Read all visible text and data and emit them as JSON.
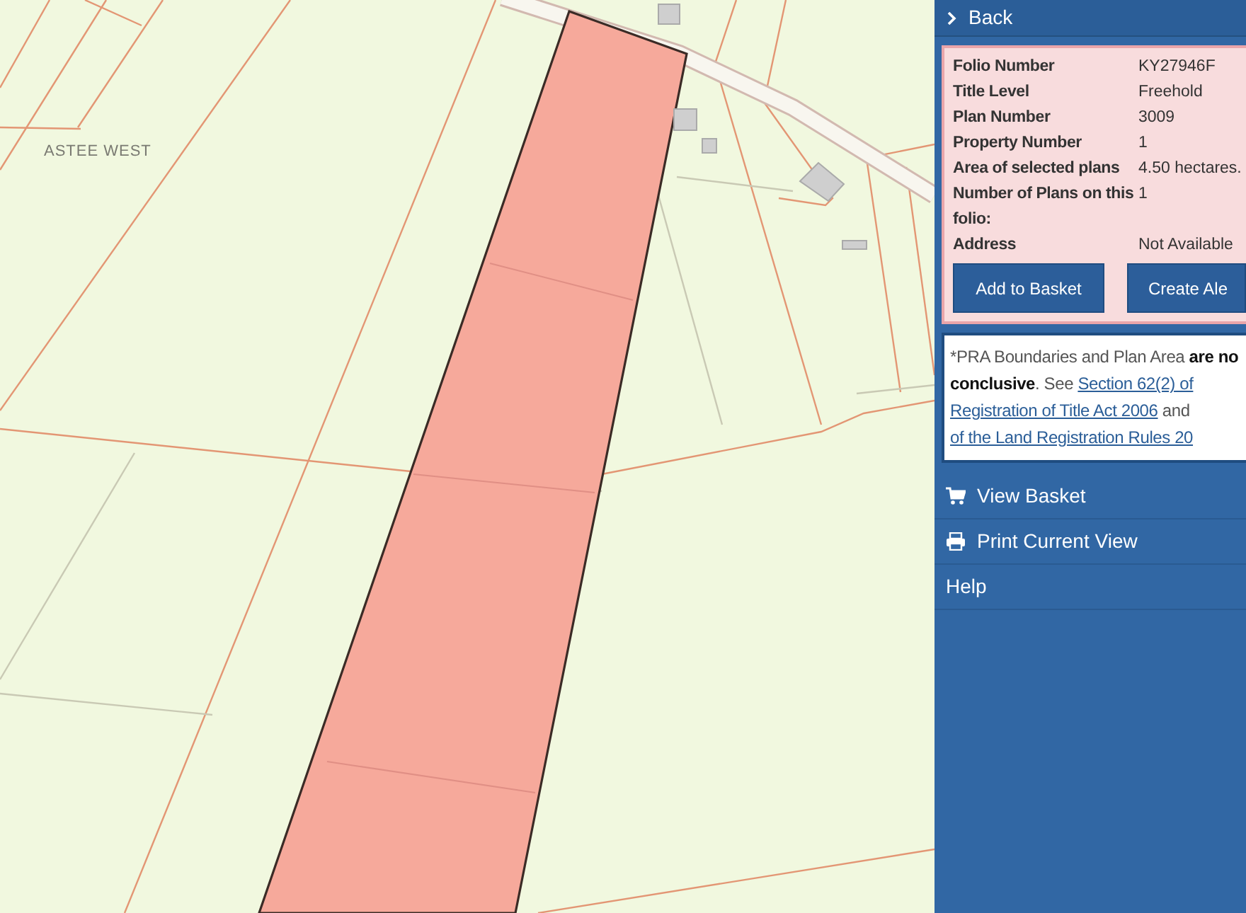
{
  "map": {
    "place_label": "ASTEE WEST"
  },
  "panel": {
    "back": "Back",
    "folio": {
      "rows": [
        {
          "label": "Folio Number",
          "value": "KY27946F"
        },
        {
          "label": "Title Level",
          "value": "Freehold"
        },
        {
          "label": "Plan Number",
          "value": "3009"
        },
        {
          "label": "Property Number",
          "value": "1"
        },
        {
          "label": "Area of selected plans",
          "value": "4.50 hectares."
        },
        {
          "label": "Number of Plans on this folio:",
          "value": "1"
        },
        {
          "label": "Address",
          "value": "Not Available"
        }
      ],
      "buttons": [
        "Add to Basket",
        "Create Ale"
      ]
    },
    "disclaimer": {
      "lines": [
        [
          {
            "kind": "text",
            "text": "*PRA Boundaries and Plan Area **are no**"
          }
        ],
        [
          {
            "kind": "text",
            "text": "**conclusive**. See "
          },
          {
            "kind": "link",
            "text": "Section 62(2) of"
          }
        ],
        [
          {
            "kind": "link",
            "text": "Registration of Title Act 2006"
          },
          {
            "kind": "text",
            "text": " and"
          }
        ],
        [
          {
            "kind": "link",
            "text": "of the Land Registration Rules 20"
          }
        ]
      ]
    },
    "menu": [
      {
        "kind": "basket",
        "label": "View Basket"
      },
      {
        "kind": "print",
        "label": "Print Current View"
      },
      {
        "kind": "plain",
        "label": "Help"
      }
    ]
  }
}
